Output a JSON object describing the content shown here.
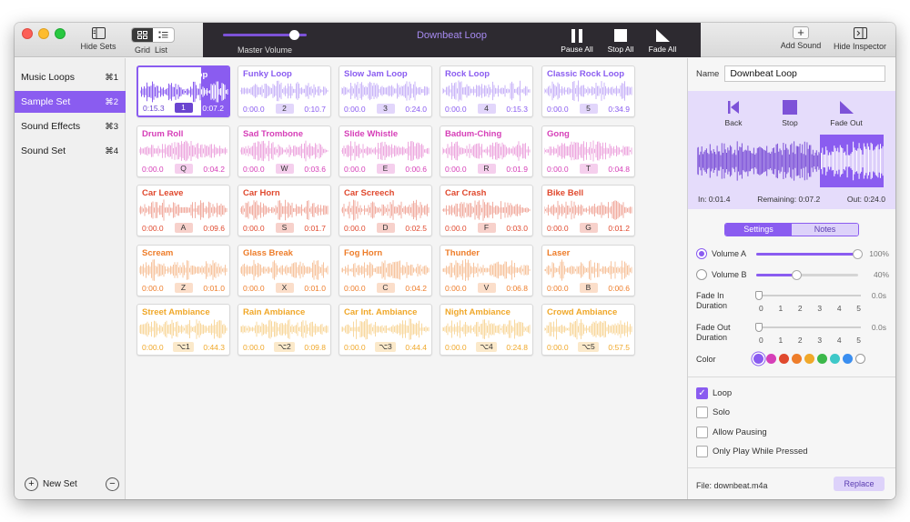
{
  "toolbar": {
    "hide_sets": "Hide Sets",
    "view_grid": "Grid",
    "view_list": "List",
    "master_volume": "Master Volume",
    "master_volume_level": 0.85,
    "now_playing": "Downbeat Loop",
    "pause_all": "Pause All",
    "stop_all": "Stop All",
    "fade_all": "Fade All",
    "add_sound": "Add Sound",
    "hide_inspector": "Hide Inspector"
  },
  "sidebar": {
    "items": [
      {
        "label": "Music Loops",
        "shortcut": "⌘1",
        "selected": false
      },
      {
        "label": "Sample Set",
        "shortcut": "⌘2",
        "selected": true
      },
      {
        "label": "Sound Effects",
        "shortcut": "⌘3",
        "selected": false
      },
      {
        "label": "Sound Set",
        "shortcut": "⌘4",
        "selected": false
      }
    ],
    "new_set": "New Set"
  },
  "grid": {
    "tiles": [
      {
        "name": "Downbeat Loop",
        "start": "0:15.3",
        "key": "1",
        "end": "0:07.2",
        "color": "#8a5cf0",
        "selected": true
      },
      {
        "name": "Funky Loop",
        "start": "0:00.0",
        "key": "2",
        "end": "0:10.7",
        "color": "#8a5cf0"
      },
      {
        "name": "Slow Jam Loop",
        "start": "0:00.0",
        "key": "3",
        "end": "0:24.0",
        "color": "#8a5cf0"
      },
      {
        "name": "Rock Loop",
        "start": "0:00.0",
        "key": "4",
        "end": "0:15.3",
        "color": "#8a5cf0"
      },
      {
        "name": "Classic Rock Loop",
        "start": "0:00.0",
        "key": "5",
        "end": "0:34.9",
        "color": "#8a5cf0"
      },
      {
        "name": "Drum Roll",
        "start": "0:00.0",
        "key": "Q",
        "end": "0:04.2",
        "color": "#d63fb8"
      },
      {
        "name": "Sad Trombone",
        "start": "0:00.0",
        "key": "W",
        "end": "0:03.6",
        "color": "#d63fb8"
      },
      {
        "name": "Slide Whistle",
        "start": "0:00.0",
        "key": "E",
        "end": "0:00.6",
        "color": "#d63fb8"
      },
      {
        "name": "Badum-Ching",
        "start": "0:00.0",
        "key": "R",
        "end": "0:01.9",
        "color": "#d63fb8"
      },
      {
        "name": "Gong",
        "start": "0:00.0",
        "key": "T",
        "end": "0:04.8",
        "color": "#d63fb8"
      },
      {
        "name": "Car Leave",
        "start": "0:00.0",
        "key": "A",
        "end": "0:09.6",
        "color": "#e0492e"
      },
      {
        "name": "Car Horn",
        "start": "0:00.0",
        "key": "S",
        "end": "0:01.7",
        "color": "#e0492e"
      },
      {
        "name": "Car Screech",
        "start": "0:00.0",
        "key": "D",
        "end": "0:02.5",
        "color": "#e0492e"
      },
      {
        "name": "Car Crash",
        "start": "0:00.0",
        "key": "F",
        "end": "0:03.0",
        "color": "#e0492e"
      },
      {
        "name": "Bike Bell",
        "start": "0:00.0",
        "key": "G",
        "end": "0:01.2",
        "color": "#e0492e"
      },
      {
        "name": "Scream",
        "start": "0:00.0",
        "key": "Z",
        "end": "0:01.0",
        "color": "#ee7d2a"
      },
      {
        "name": "Glass Break",
        "start": "0:00.0",
        "key": "X",
        "end": "0:01.0",
        "color": "#ee7d2a"
      },
      {
        "name": "Fog Horn",
        "start": "0:00.0",
        "key": "C",
        "end": "0:04.2",
        "color": "#ee7d2a"
      },
      {
        "name": "Thunder",
        "start": "0:00.0",
        "key": "V",
        "end": "0:06.8",
        "color": "#ee7d2a"
      },
      {
        "name": "Laser",
        "start": "0:00.0",
        "key": "B",
        "end": "0:00.6",
        "color": "#ee7d2a"
      },
      {
        "name": "Street Ambiance",
        "start": "0:00.0",
        "key": "⌥1",
        "end": "0:44.3",
        "color": "#f0a82a"
      },
      {
        "name": "Rain Ambiance",
        "start": "0:00.0",
        "key": "⌥2",
        "end": "0:09.8",
        "color": "#f0a82a"
      },
      {
        "name": "Car Int. Ambiance",
        "start": "0:00.0",
        "key": "⌥3",
        "end": "0:44.4",
        "color": "#f0a82a"
      },
      {
        "name": "Night Ambiance",
        "start": "0:00.0",
        "key": "⌥4",
        "end": "0:24.8",
        "color": "#f0a82a"
      },
      {
        "name": "Crowd Ambiance",
        "start": "0:00.0",
        "key": "⌥5",
        "end": "0:57.5",
        "color": "#f0a82a"
      }
    ]
  },
  "inspector": {
    "name_label": "Name",
    "name_value": "Downbeat Loop",
    "back": "Back",
    "stop": "Stop",
    "fade_out": "Fade Out",
    "in_time": "In: 0:01.4",
    "remaining": "Remaining: 0:07.2",
    "out_time": "Out: 0:24.0",
    "tab_settings": "Settings",
    "tab_notes": "Notes",
    "volume_a": "Volume A",
    "volume_a_pct": "100%",
    "volume_a_level": 1.0,
    "volume_b": "Volume B",
    "volume_b_pct": "40%",
    "volume_b_level": 0.4,
    "fade_in_label": "Fade In Duration",
    "fade_in_value": "0.0s",
    "fade_out_label": "Fade Out Duration",
    "fade_out_value": "0.0s",
    "fade_ticks": [
      "0",
      "1",
      "2",
      "3",
      "4",
      "5"
    ],
    "color_label": "Color",
    "colors": [
      "#8a5cf0",
      "#d63fb8",
      "#e0492e",
      "#ee7d2a",
      "#f0a82a",
      "#3cb84a",
      "#3ec8c8",
      "#3a8ef0",
      "#ffffff"
    ],
    "loop": "Loop",
    "solo": "Solo",
    "allow_pausing": "Allow Pausing",
    "only_play_while_pressed": "Only Play While Pressed",
    "file": "File: downbeat.m4a",
    "replace": "Replace"
  }
}
